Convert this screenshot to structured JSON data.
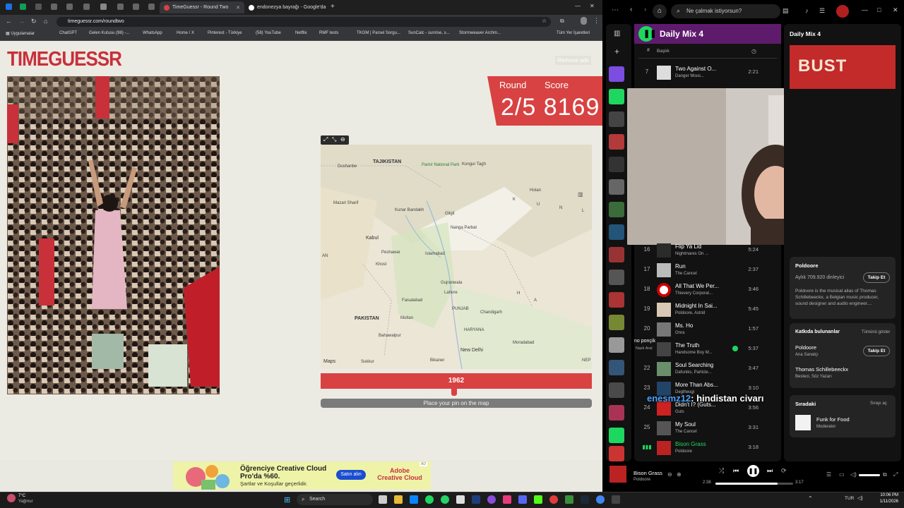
{
  "browser": {
    "tabs": [
      {
        "label": "TimeGuessr - Round Two",
        "active": true
      },
      {
        "label": "endonezya bayrağı - Google'da",
        "active": false
      }
    ],
    "url": "timeguessr.com/roundtwo",
    "bookmarks": [
      "Uygulamalar",
      "ChatGPT",
      "Gelen Kutusu (98) -...",
      "WhatsApp",
      "Home / X",
      "Pinterest - Türkiye",
      "(58) YouTube",
      "Netflix",
      "RMF tests",
      "TKGM | Parsel Sorgu...",
      "SunCalc - sunrise, s...",
      "Stormweaver Archm..."
    ],
    "all_bookmarks": "Tüm Yer İşaretleri"
  },
  "game": {
    "logo": "TIMEGUESSR",
    "remove_ads": "Remove ads",
    "round_label": "Round",
    "score_label": "Score",
    "round_value": "2/5",
    "score_value": "8169",
    "year": "1962",
    "place_pin": "Place your pin on the map",
    "map_attribution": "Maps",
    "map_labels": [
      "TAJIKISTAN",
      "Dushanbe",
      "Pamir National Park",
      "Kongur Tagh",
      "Hotan",
      "Mazari Sharif",
      "Kunar Bandakh",
      "Gilgit",
      "Nanga Parbat",
      "Kabul",
      "Peshawar",
      "Islamabad",
      "Khost",
      "Gujranwala",
      "Lahore",
      "Faisalabad",
      "PUNJAB",
      "Chandigarh",
      "PAKISTAN",
      "Multan",
      "Bahawalpur",
      "HARYANA",
      "New Delhi",
      "Moradabad",
      "Sukkur",
      "Bikaner",
      "AN",
      "NEP",
      "K",
      "U",
      "N",
      "L",
      "H",
      "A"
    ]
  },
  "ad": {
    "headline": "Öğrenciye Creative Cloud Pro'da %60.",
    "sub": "Şartlar ve Koşullar geçerlidir.",
    "button": "Satın alın",
    "brand": "Adobe Creative Cloud",
    "badge": "AD"
  },
  "spotify": {
    "search_placeholder": "Ne çalmak istiyorsun?",
    "playlist_title": "Daily Mix 4",
    "col_num": "#",
    "col_title": "Başlık",
    "tracks": [
      {
        "n": "7",
        "title": "Two Against O...",
        "artist": "Danger Mous...",
        "dur": "2:21"
      },
      {
        "n": "16",
        "title": "Flip Ya Lid",
        "artist": "Nightmares On ...",
        "dur": "5:24"
      },
      {
        "n": "17",
        "title": "Run",
        "artist": "The Cancel",
        "dur": "2:37"
      },
      {
        "n": "18",
        "title": "All That We Per...",
        "artist": "Thievery Corporat...",
        "dur": "3:46"
      },
      {
        "n": "19",
        "title": "Midnight In Sai...",
        "artist": "Poldoore, Astrid",
        "dur": "5:45"
      },
      {
        "n": "20",
        "title": "Ms. Ho",
        "artist": "Onra",
        "dur": "1:57"
      },
      {
        "n": "",
        "title": "The Truth",
        "artist": "Handsome Boy M...",
        "dur": "5:37"
      },
      {
        "n": "22",
        "title": "Soul Searching",
        "artist": "Dafuniks, Particle...",
        "dur": "3:47"
      },
      {
        "n": "23",
        "title": "More Than Abs...",
        "artist": "Deglheugi",
        "dur": "3:10"
      },
      {
        "n": "24",
        "title": "Didn't I? (Guts...",
        "artist": "Guts",
        "dur": "3:56"
      },
      {
        "n": "25",
        "title": "My Soul",
        "artist": "The Cancel",
        "dur": "3:31"
      },
      {
        "n": "",
        "title": "Bison Grass",
        "artist": "Poldoore",
        "dur": "3:18"
      }
    ],
    "right_title": "Daily Mix 4",
    "artist_name": "Poldoore",
    "listeners": "Aylık 709.920 dinleyici",
    "follow": "Takip Et",
    "bio": "Poldoore is the musical alias of Thomas Schillebeeckx, a Belgian music producer, sound designer and audio engineer....",
    "contributors_title": "Katkıda bulunanlar",
    "show_all": "Tümünü göster",
    "contributors": [
      {
        "name": "Poldoore",
        "role": "Ana Sanatçı"
      },
      {
        "name": "Thomas Schillebeeckx",
        "role": "Besteci, Söz Yazarı"
      }
    ],
    "queue_title": "Sıradaki",
    "queue_open": "Sırayı aç",
    "queue_track": "Funk for Food",
    "queue_artist": "Moderator",
    "now_title": "Bison Grass",
    "now_artist": "Poldoore",
    "time_elapsed": "2:38",
    "time_total": "3:17",
    "progress": 0.8,
    "overlay_user": "no ponçik",
    "overlay_user_sub": "Nazlı Aral",
    "kick_count": "17"
  },
  "chat": {
    "user": "enesmz12",
    "message": ": hindistan civarı"
  },
  "taskbar": {
    "weather_temp": "7°C",
    "weather_text": "Yağmur",
    "search": "Search",
    "lang": "TUR",
    "time": "10:06 PM",
    "date": "1/11/2026"
  },
  "colors": {
    "accent_red": "#d84242",
    "spotify_green": "#1ed760",
    "playlist_header": "#5e1b6c"
  }
}
